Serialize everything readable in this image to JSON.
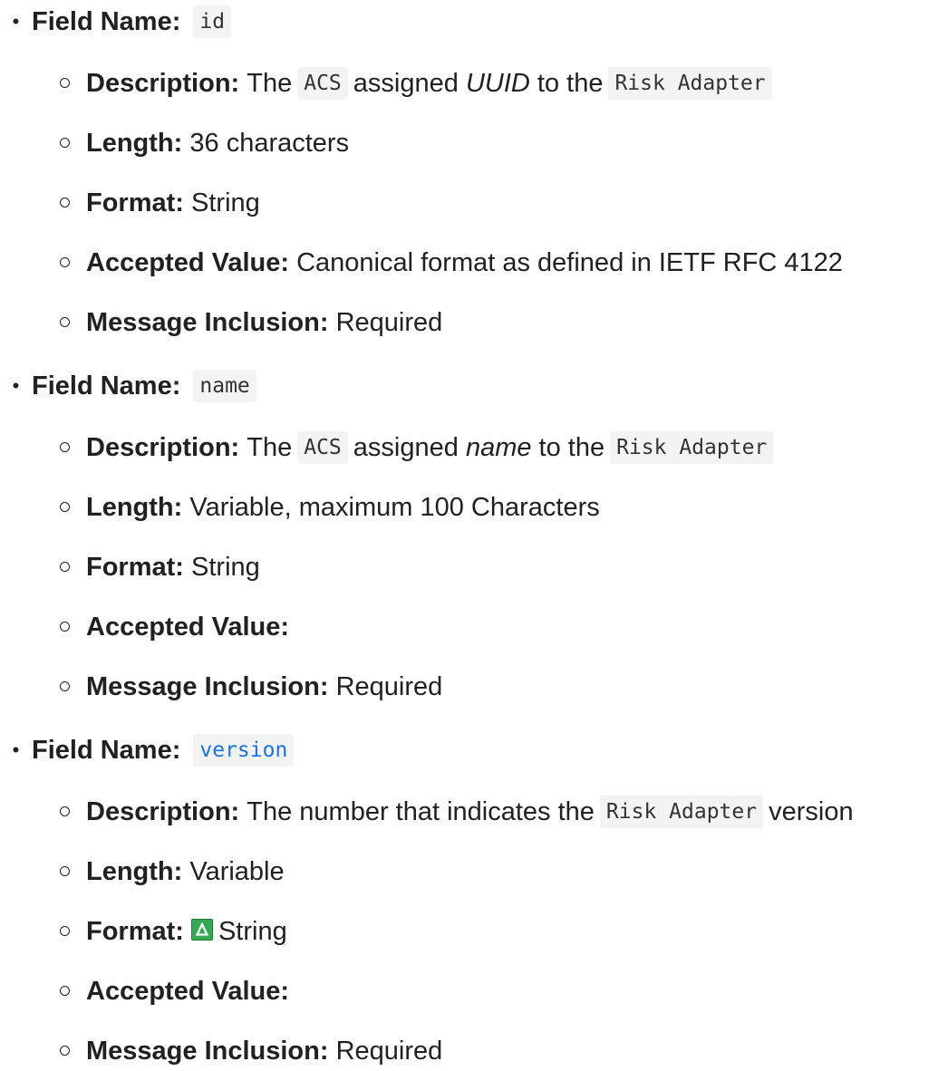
{
  "fields": [
    {
      "label": "Field Name:",
      "name": "id",
      "properties": {
        "description": {
          "label": "Description:",
          "pre": "The",
          "code1": "ACS",
          "mid": "assigned",
          "em": "UUID",
          "post": "to the",
          "code2": "Risk Adapter"
        },
        "length": {
          "label": "Length:",
          "value": "36 characters"
        },
        "format": {
          "label": "Format:",
          "value": "String"
        },
        "accepted": {
          "label": "Accepted Value:",
          "value": "Canonical format as defined in IETF RFC 4122"
        },
        "inclusion": {
          "label": "Message Inclusion:",
          "value": "Required"
        }
      }
    },
    {
      "label": "Field Name:",
      "name": "name",
      "properties": {
        "description": {
          "label": "Description:",
          "pre": "The",
          "code1": "ACS",
          "mid": "assigned",
          "em": "name",
          "post": "to the",
          "code2": "Risk Adapter"
        },
        "length": {
          "label": "Length:",
          "value": "Variable, maximum 100 Characters"
        },
        "format": {
          "label": "Format:",
          "value": "String"
        },
        "accepted": {
          "label": "Accepted Value:",
          "value": ""
        },
        "inclusion": {
          "label": "Message Inclusion:",
          "value": "Required"
        }
      }
    },
    {
      "label": "Field Name:",
      "name": "version",
      "properties": {
        "description": {
          "label": "Description:",
          "pre": "The number that indicates the",
          "code": "Risk Adapter",
          "post": "version"
        },
        "length": {
          "label": "Length:",
          "value": "Variable"
        },
        "format": {
          "label": "Format:",
          "value": "String",
          "icon": "delta-icon",
          "icon_color": "#34a853"
        },
        "accepted": {
          "label": "Accepted Value:",
          "value": ""
        },
        "inclusion": {
          "label": "Message Inclusion:",
          "value": "Required"
        }
      }
    }
  ],
  "colors": {
    "text": "#212121",
    "code_background": "#f3f3f3",
    "link": "#1a73e8"
  }
}
